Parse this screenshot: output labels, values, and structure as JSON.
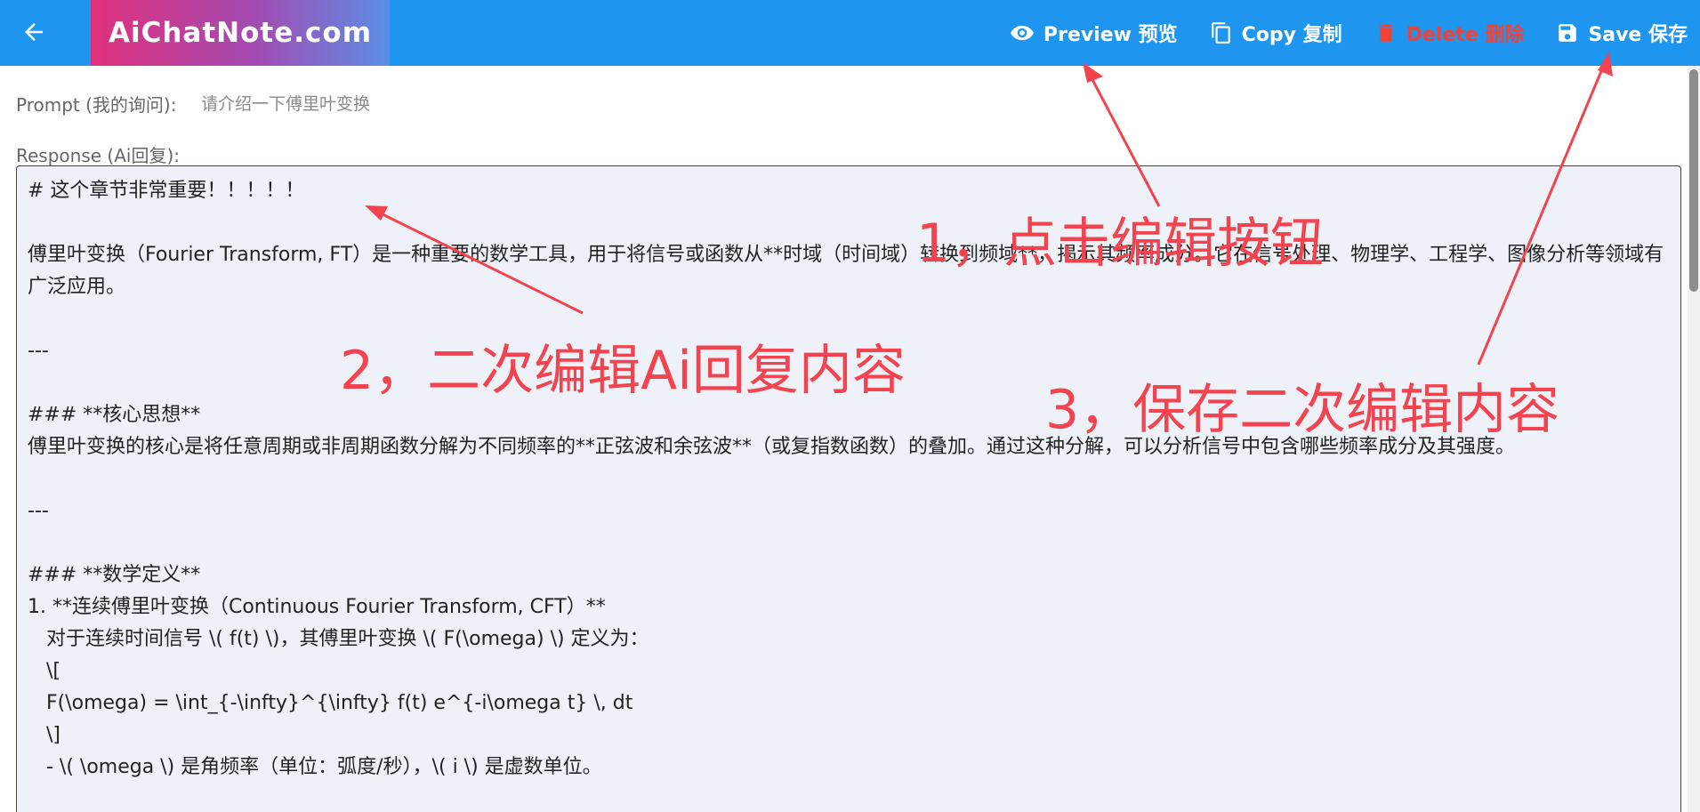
{
  "header": {
    "logo": "AiChatNote.com",
    "actions": {
      "preview": "Preview 预览",
      "copy": "Copy 复制",
      "delete": "Delete 删除",
      "save": "Save 保存"
    }
  },
  "form": {
    "prompt_label": "Prompt (我的询问):",
    "prompt_value": "请介绍一下傅里叶变换",
    "response_label": "Response (Ai回复):",
    "response_text": "# 这个章节非常重要！！！！！\n\n傅里叶变换（Fourier Transform, FT）是一种重要的数学工具，用于将信号或函数从**时域（时间域）转换到频域**，揭示其频率成分。它在信号处理、物理学、工程学、图像分析等领域有广泛应用。\n\n---\n\n### **核心思想**\n傅里叶变换的核心是将任意周期或非周期函数分解为不同频率的**正弦波和余弦波**（或复指数函数）的叠加。通过这种分解，可以分析信号中包含哪些频率成分及其强度。\n\n---\n\n### **数学定义**\n1. **连续傅里叶变换（Continuous Fourier Transform, CFT）**\n   对于连续时间信号 \\( f(t) \\)，其傅里叶变换 \\( F(\\omega) \\) 定义为：\n   \\[\n   F(\\omega) = \\int_{-\\infty}^{\\infty} f(t) e^{-i\\omega t} \\, dt\n   \\]\n   - \\( \\omega \\) 是角频率（单位：弧度/秒），\\( i \\) 是虚数单位。"
  },
  "annotations": {
    "step1": "1，点击编辑按钮",
    "step2": "2，二次编辑Ai回复内容",
    "step3": "3，保存二次编辑内容"
  },
  "colors": {
    "topbar": "#1e96f0",
    "delete": "#f0443a",
    "annotation": "#f2434e",
    "editor_bg": "#eef2f8"
  },
  "icons": {
    "back": "arrow-left-icon",
    "preview": "eye-icon",
    "copy": "copy-icon",
    "delete": "trash-icon",
    "save": "floppy-disk-icon"
  }
}
